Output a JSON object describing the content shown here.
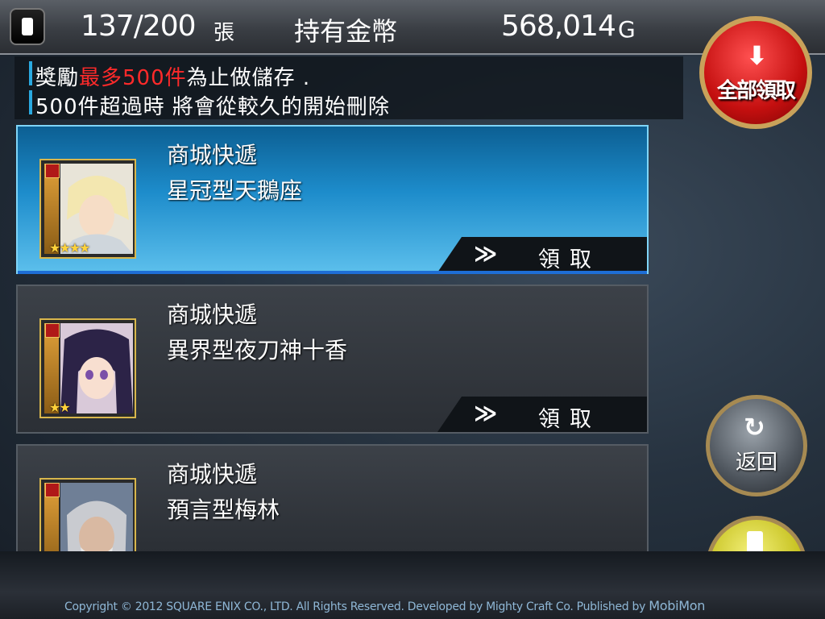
{
  "header": {
    "cards_count": "137/200",
    "cards_unit": "張",
    "coins_label": "持有金幣",
    "coins_value": "568,014",
    "coins_unit": "G"
  },
  "notice": {
    "line1_before": "獎勵",
    "line1_highlight": "最多500件",
    "line1_after": "為止做儲存 .",
    "line2": "500件超過時 將會從較久的開始刪除"
  },
  "buttons": {
    "all_claim": "全部領取",
    "back": "返回"
  },
  "items": [
    {
      "sender": "商城快遞",
      "item": "星冠型天鵝座",
      "stars": "★★★★",
      "claim": "領取",
      "arrows": "≫"
    },
    {
      "sender": "商城快遞",
      "item": "異界型夜刀神十香",
      "stars": "★★",
      "claim": "領取",
      "arrows": "≫"
    },
    {
      "sender": "商城快遞",
      "item": "預言型梅林"
    }
  ],
  "footer": {
    "copyright": "Copyright © 2012 SQUARE ENIX CO., LTD.  All Rights Reserved. Developed by Mighty Craft Co. Published by ",
    "brand": "MobiMon"
  },
  "colors": {
    "highlight": "#ff2a2a",
    "selected_panel": "#1d8ccb",
    "accent": "#2aa9e0"
  }
}
